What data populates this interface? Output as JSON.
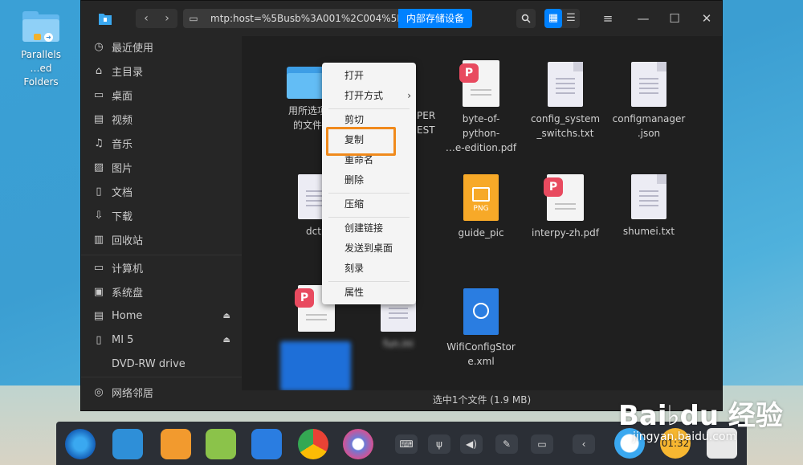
{
  "desktop": {
    "icon_label_line1": "Parallels",
    "icon_label_line2": "…ed Folders"
  },
  "toolbar": {
    "path": "mtp:host=%5Busb%3A001%2C004%5D",
    "crumb": "内部存储设备"
  },
  "sidebar": {
    "items": [
      {
        "label": "最近使用",
        "icon": "clock-icon"
      },
      {
        "label": "主目录",
        "icon": "home-icon"
      },
      {
        "label": "桌面",
        "icon": "desktop-icon"
      },
      {
        "label": "视频",
        "icon": "video-icon"
      },
      {
        "label": "音乐",
        "icon": "music-icon"
      },
      {
        "label": "图片",
        "icon": "picture-icon"
      },
      {
        "label": "文档",
        "icon": "document-icon"
      },
      {
        "label": "下载",
        "icon": "download-icon"
      },
      {
        "label": "回收站",
        "icon": "trash-icon"
      }
    ],
    "devices": [
      {
        "label": "计算机",
        "icon": "computer-icon"
      },
      {
        "label": "系统盘",
        "icon": "disk-icon"
      },
      {
        "label": "Home",
        "icon": "drive-icon"
      },
      {
        "label": "MI 5",
        "icon": "phone-icon"
      },
      {
        "label": "DVD-RW drive",
        "icon": ""
      }
    ],
    "network": {
      "label": "网络邻居",
      "icon": "network-icon"
    }
  },
  "files": {
    "folder_name_l1": "用所选项",
    "folder_name_l2": "的文件",
    "second_name_l1": "PER",
    "second_name_l2": "EST",
    "byte_name_l1": "byte-of-",
    "byte_name_l2": "python-",
    "byte_name_l3": "…e-edition.pdf",
    "config_sys_l1": "config_system",
    "config_sys_l2": "_switchs.txt",
    "config_mgr_l1": "configmanager",
    "config_mgr_l2": ".json",
    "dct_name": "dctp",
    "guide_name": "guide_pic",
    "png_label": "PNG",
    "interpy_name": "interpy-zh.pdf",
    "shumei_name": "shumei.txt",
    "ini_name": "fun.ini",
    "wifi_l1": "WifiConfigStor",
    "wifi_l2": "e.xml"
  },
  "context_menu": {
    "open": "打开",
    "open_with": "打开方式",
    "cut": "剪切",
    "copy": "复制",
    "rename": "重命名",
    "delete": "删除",
    "compress": "压缩",
    "create_link": "创建链接",
    "send_to_desktop": "发送到桌面",
    "burn": "刻录",
    "properties": "属性"
  },
  "status": {
    "text": "选中1个文件 (1.9 MB)"
  },
  "dock": {
    "clock_text": "01:32"
  },
  "watermark": {
    "big": "Bai♭du 经验",
    "small": "jingyan.baidu.com"
  },
  "colors": {
    "accent": "#0081ff",
    "highlight_box": "#f08a1c"
  }
}
